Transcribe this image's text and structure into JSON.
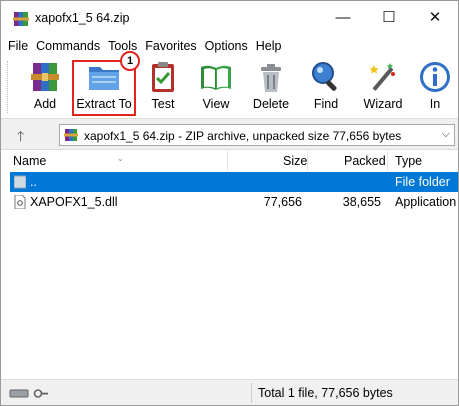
{
  "window": {
    "title": "xapofx1_5 64.zip",
    "controls": {
      "minimize": "—",
      "maximize": "☐",
      "close": "✕"
    }
  },
  "menu": [
    "File",
    "Commands",
    "Tools",
    "Favorites",
    "Options",
    "Help"
  ],
  "toolbar": {
    "buttons": [
      {
        "label": "Add",
        "icon": "add-archive-icon"
      },
      {
        "label": "Extract To",
        "icon": "extract-folder-icon"
      },
      {
        "label": "Test",
        "icon": "test-clipboard-icon"
      },
      {
        "label": "View",
        "icon": "view-book-icon"
      },
      {
        "label": "Delete",
        "icon": "trash-icon"
      },
      {
        "label": "Find",
        "icon": "magnifier-icon"
      },
      {
        "label": "Wizard",
        "icon": "wand-icon"
      },
      {
        "label": "In",
        "icon": "info-icon"
      }
    ],
    "highlight_badge": "1",
    "highlight_color": "#e0241f"
  },
  "address": {
    "up_arrow": "🡑",
    "text": "xapofx1_5 64.zip - ZIP archive, unpacked size 77,656 bytes",
    "chevron": "⌵"
  },
  "columns": {
    "name": "Name",
    "size": "Size",
    "packed": "Packed",
    "type": "Type"
  },
  "rows": [
    {
      "name": "..",
      "size": "",
      "packed": "",
      "type": "File folder",
      "selected": true
    },
    {
      "name": "XAPOFX1_5.dll",
      "size": "77,656",
      "packed": "38,655",
      "type": "Application",
      "selected": false
    }
  ],
  "status": {
    "text": "Total 1 file, 77,656 bytes"
  },
  "colors": {
    "selection": "#0078d7",
    "accent": "#e0241f"
  }
}
